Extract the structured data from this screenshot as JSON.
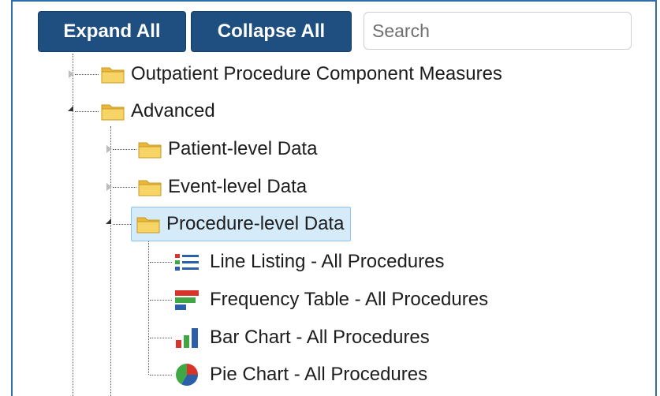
{
  "toolbar": {
    "expand_label": "Expand All",
    "collapse_label": "Collapse All",
    "search_placeholder": "Search"
  },
  "tree": {
    "outpatient": "Outpatient Procedure Component Measures",
    "advanced": "Advanced",
    "patient_level": "Patient-level Data",
    "event_level": "Event-level Data",
    "procedure_level": "Procedure-level Data",
    "reports": {
      "line_listing": "Line Listing - All Procedures",
      "frequency_table": "Frequency Table - All Procedures",
      "bar_chart": "Bar Chart - All Procedures",
      "pie_chart": "Pie Chart - All Procedures"
    }
  },
  "colors": {
    "button": "#1f4f80",
    "selection": "#d6ebfa",
    "folder": "#f3c544",
    "icon_red": "#d9342b",
    "icon_blue": "#2b5fa8",
    "icon_green": "#3fa845"
  },
  "icons": [
    "folder-icon",
    "line-listing-icon",
    "frequency-table-icon",
    "bar-chart-icon",
    "pie-chart-icon"
  ]
}
